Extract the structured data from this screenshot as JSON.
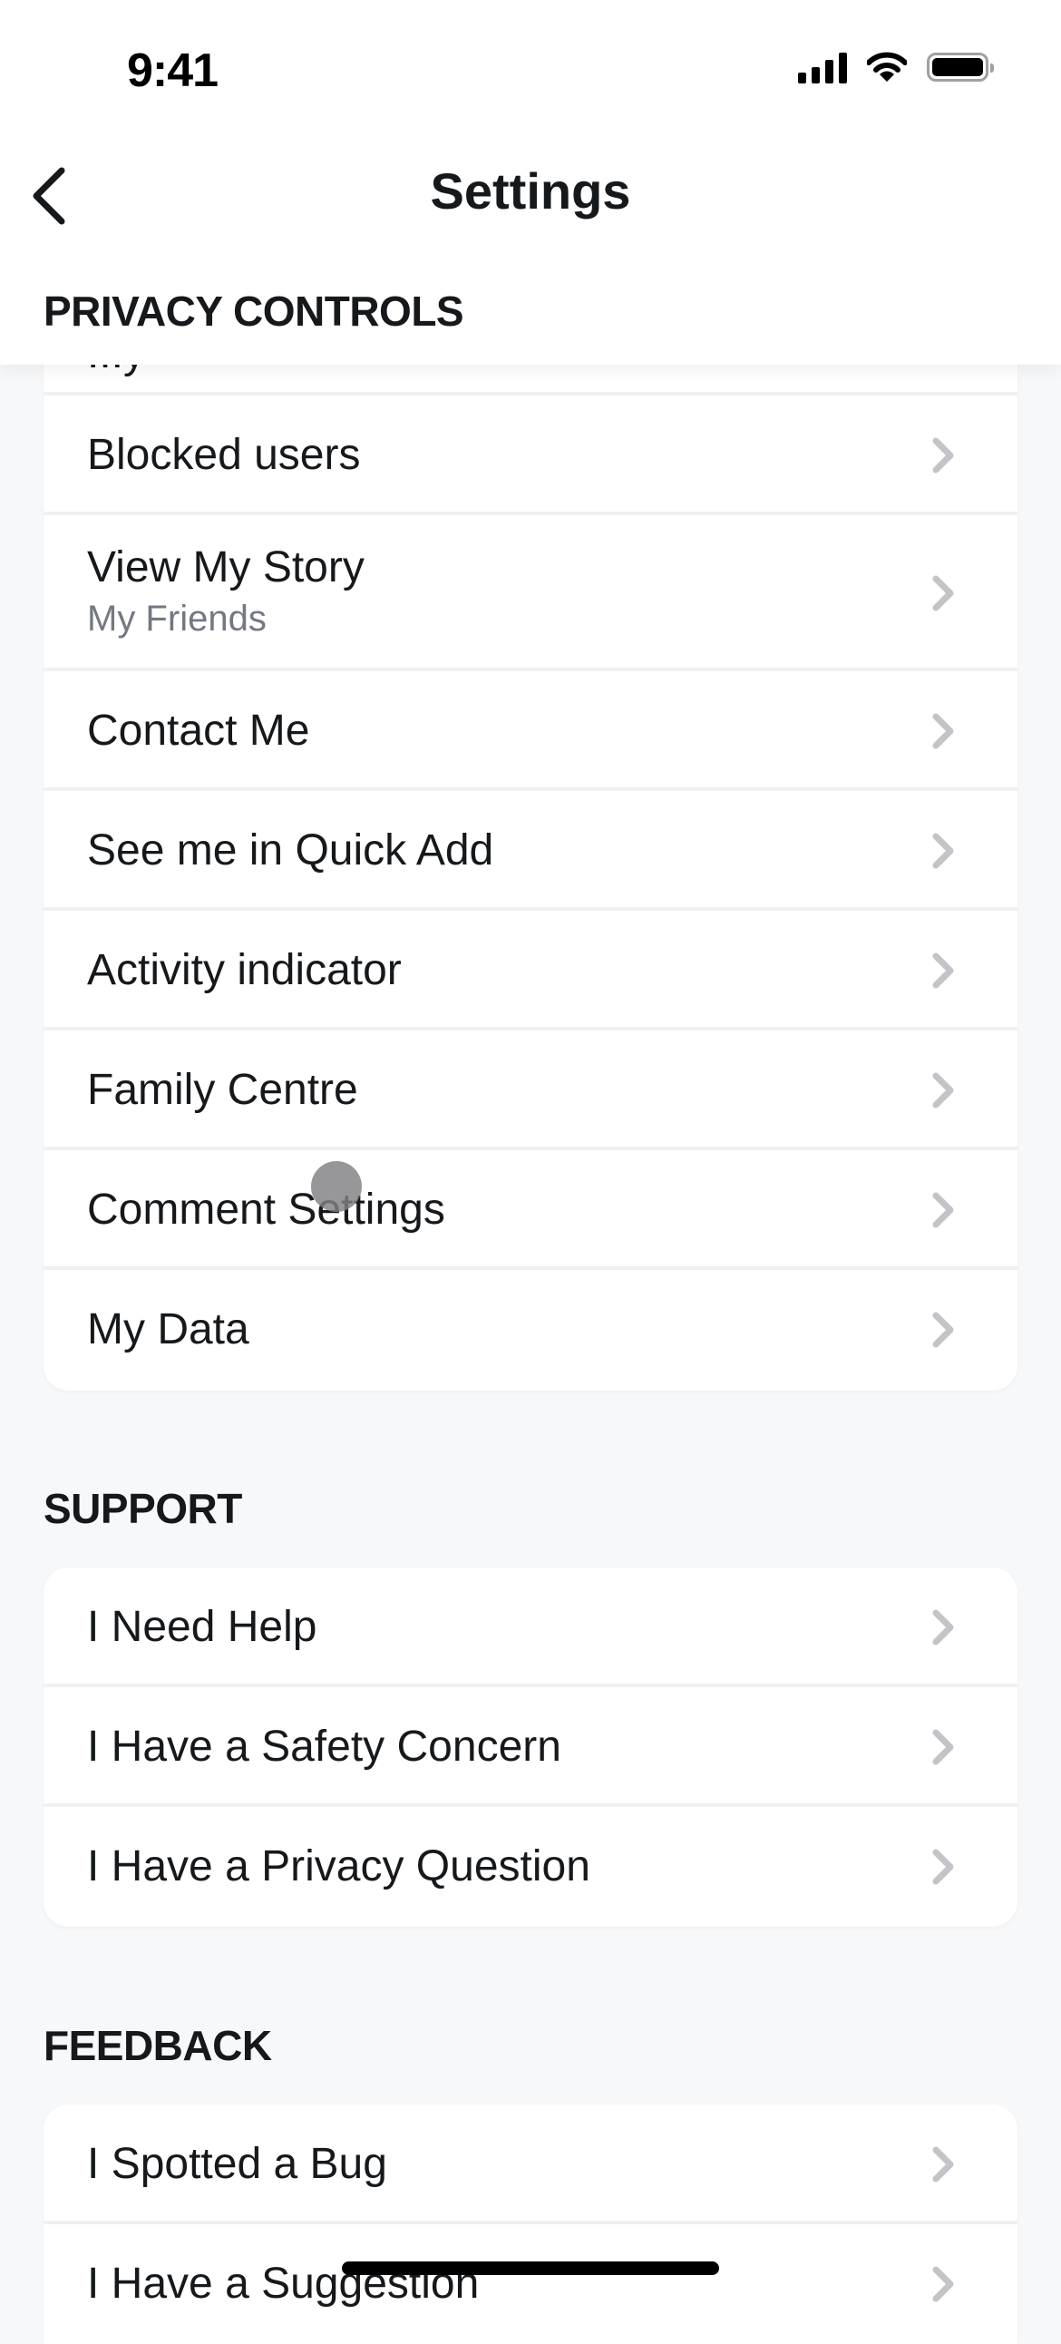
{
  "status_bar": {
    "time": "9:41",
    "icons": [
      "cellular-signal-icon",
      "wifi-icon",
      "battery-icon"
    ]
  },
  "nav": {
    "back_icon": "chevron-left-icon",
    "title": "Settings"
  },
  "sections": {
    "privacy": {
      "title": "PRIVACY CONTROLS",
      "partial_item_label": "...y",
      "items": [
        {
          "label": "Blocked users"
        },
        {
          "label": "View My Story",
          "sublabel": "My Friends"
        },
        {
          "label": "Contact Me"
        },
        {
          "label": "See me in Quick Add"
        },
        {
          "label": "Activity indicator"
        },
        {
          "label": "Family Centre"
        },
        {
          "label": "Comment Settings"
        },
        {
          "label": "My Data"
        }
      ]
    },
    "support": {
      "title": "SUPPORT",
      "items": [
        {
          "label": "I Need Help"
        },
        {
          "label": "I Have a Safety Concern"
        },
        {
          "label": "I Have a Privacy Question"
        }
      ]
    },
    "feedback": {
      "title": "FEEDBACK",
      "items": [
        {
          "label": "I Spotted a Bug"
        },
        {
          "label": "I Have a Suggestion"
        }
      ]
    }
  },
  "row_icon": "chevron-right-icon",
  "colors": {
    "background": "#f7f8fa",
    "card": "#ffffff",
    "text_primary": "#16191c",
    "text_secondary": "#737882",
    "chevron": "#c2c4c8",
    "divider": "#eff0f2"
  }
}
